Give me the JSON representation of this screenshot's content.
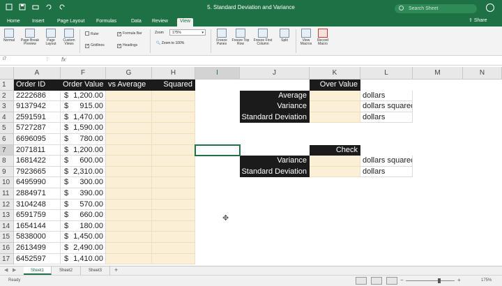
{
  "window": {
    "title": "5. Standard Deviation and Variance",
    "search_placeholder": "Search Sheet"
  },
  "tabs": [
    "Home",
    "Insert",
    "Page Layout",
    "Formulas",
    "Data",
    "Review",
    "View"
  ],
  "active_tab": "View",
  "share_label": "Share",
  "ribbon": {
    "normal": "Normal",
    "page_break": "Page Break Preview",
    "page_layout": "Page Layout",
    "custom_views": "Custom Views",
    "ruler": "Ruler",
    "formula_bar": "Formula Bar",
    "gridlines": "Gridlines",
    "headings": "Headings",
    "zoom_label": "Zoom",
    "zoom_value": "175%",
    "zoom_to_100": "Zoom to 100%",
    "freeze_panes": "Freeze Panes",
    "freeze_top_row": "Freeze Top Row",
    "freeze_first_column": "Freeze First Column",
    "split": "Split",
    "view_macros": "View Macros",
    "record_macro": "Record Macro"
  },
  "formula_bar": {
    "name_box": "I7",
    "fx": "fx",
    "content": ""
  },
  "columns": [
    "A",
    "F",
    "G",
    "H",
    "I",
    "J",
    "K",
    "L",
    "M",
    "N"
  ],
  "row_numbers": [
    "1",
    "2",
    "3",
    "4",
    "5",
    "6",
    "7",
    "8",
    "9",
    "10",
    "11",
    "12",
    "13",
    "14",
    "15",
    "16",
    "17"
  ],
  "table": {
    "headers": {
      "order_id": "Order ID",
      "order_value": "Order Value",
      "vs_average": "vs Average",
      "squared": "Squared"
    },
    "rows": [
      {
        "id": "2222686",
        "value": "1,200.00"
      },
      {
        "id": "9137942",
        "value": "915.00"
      },
      {
        "id": "2591591",
        "value": "1,470.00"
      },
      {
        "id": "5727287",
        "value": "1,590.00"
      },
      {
        "id": "6696095",
        "value": "780.00"
      },
      {
        "id": "2071811",
        "value": "1,200.00"
      },
      {
        "id": "1681422",
        "value": "600.00"
      },
      {
        "id": "7923665",
        "value": "2,310.00"
      },
      {
        "id": "6495990",
        "value": "300.00"
      },
      {
        "id": "2884971",
        "value": "390.00"
      },
      {
        "id": "3104248",
        "value": "570.00"
      },
      {
        "id": "6591759",
        "value": "660.00"
      },
      {
        "id": "1654144",
        "value": "180.00"
      },
      {
        "id": "5838000",
        "value": "1,450.00"
      },
      {
        "id": "2613499",
        "value": "2,490.00"
      },
      {
        "id": "6452597",
        "value": "1,410.00"
      }
    ],
    "currency_symbol": "$"
  },
  "summary": {
    "over_value_header": "Over Value",
    "average_label": "Average",
    "variance_label": "Variance",
    "stdev_label": "Standard Deviation",
    "unit_dollars": "dollars",
    "unit_dollars_squared": "dollars squared",
    "check_header": "Check",
    "check_variance_label": "Variance",
    "check_stdev_label": "Standard Deviation",
    "check_unit_variance": "dollars squared",
    "check_unit_stdev": "dollars"
  },
  "sheets": [
    "Sheet1",
    "Sheet2",
    "Sheet3"
  ],
  "active_sheet": "Sheet1",
  "status": {
    "ready": "Ready",
    "zoom": "175%"
  },
  "colors": {
    "excel_green": "#1e7145",
    "header_black": "#1b1b1b",
    "input_peach": "#fcefd7"
  }
}
